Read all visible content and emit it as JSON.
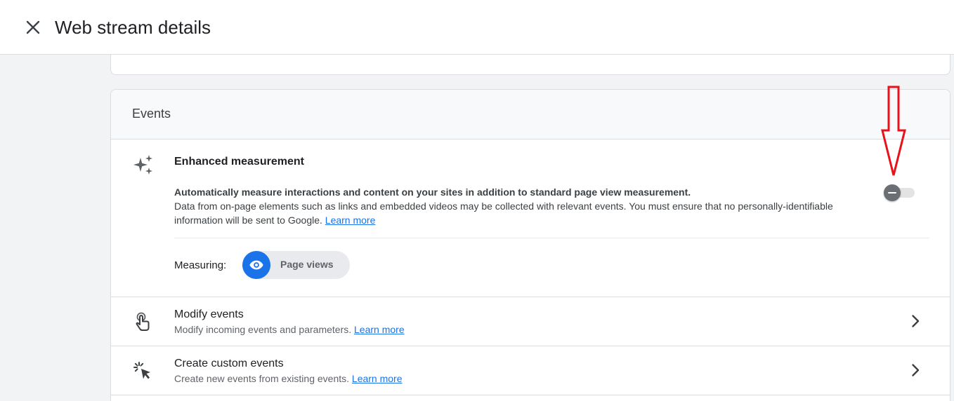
{
  "header": {
    "title": "Web stream details"
  },
  "events_card": {
    "title": "Events",
    "enhanced_measurement": {
      "title": "Enhanced measurement",
      "description_bold": "Automatically measure interactions and content on your sites in addition to standard page view measurement.",
      "description_rest": "Data from on-page elements such as links and embedded videos may be collected with relevant events. You must ensure that no personally-identifiable information will be sent to Google.",
      "learn_more": "Learn more",
      "toggle_state": "off",
      "measuring_label": "Measuring:",
      "chip_label": "Page views"
    },
    "rows": [
      {
        "title": "Modify events",
        "subtitle": "Modify incoming events and parameters.",
        "learn_more": "Learn more"
      },
      {
        "title": "Create custom events",
        "subtitle": "Create new events from existing events.",
        "learn_more": "Learn more"
      }
    ]
  },
  "icons": {
    "close": "close-icon",
    "sparkle": "sparkle-icon",
    "touch": "touch-icon",
    "cursor_click": "cursor-click-icon",
    "chevron": "chevron-right-icon",
    "eye": "eye-icon"
  },
  "colors": {
    "accent": "#1a73e8",
    "annotation": "#e8121c"
  }
}
